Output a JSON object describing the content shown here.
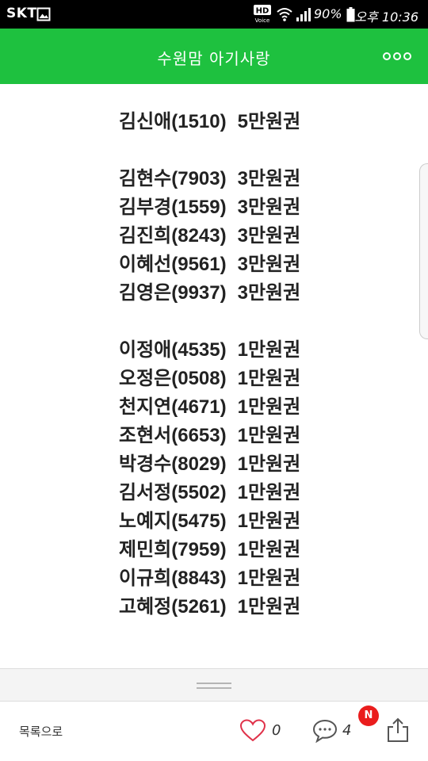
{
  "status_bar": {
    "carrier": "SKT",
    "hd_label": "HD",
    "voice_label": "Voice",
    "battery": "90%",
    "time": "오후 10:36"
  },
  "header": {
    "title": "수원맘 아기사랑"
  },
  "winners": {
    "groups": [
      [
        {
          "name": "김신애(1510)",
          "prize": "5만원권"
        }
      ],
      [
        {
          "name": "김현수(7903)",
          "prize": "3만원권"
        },
        {
          "name": "김부경(1559)",
          "prize": "3만원권"
        },
        {
          "name": "김진희(8243)",
          "prize": "3만원권"
        },
        {
          "name": "이혜선(9561)",
          "prize": "3만원권"
        },
        {
          "name": "김영은(9937)",
          "prize": "3만원권"
        }
      ],
      [
        {
          "name": "이정애(4535)",
          "prize": "1만원권"
        },
        {
          "name": "오정은(0508)",
          "prize": "1만원권"
        },
        {
          "name": "천지연(4671)",
          "prize": "1만원권"
        },
        {
          "name": "조현서(6653)",
          "prize": "1만원권"
        },
        {
          "name": "박경수(8029)",
          "prize": "1만원권"
        },
        {
          "name": "김서정(5502)",
          "prize": "1만원권"
        },
        {
          "name": "노예지(5475)",
          "prize": "1만원권"
        },
        {
          "name": "제민희(7959)",
          "prize": "1만원권"
        },
        {
          "name": "이규희(8843)",
          "prize": "1만원권"
        },
        {
          "name": "고혜정(5261)",
          "prize": "1만원권"
        }
      ]
    ]
  },
  "bottom_bar": {
    "back_label": "목록으로",
    "like_count": "0",
    "comment_count": "4",
    "new_badge": "N"
  },
  "colors": {
    "header_bg": "#1ec13f",
    "badge": "#ea1d1d",
    "heart": "#e0324a"
  }
}
